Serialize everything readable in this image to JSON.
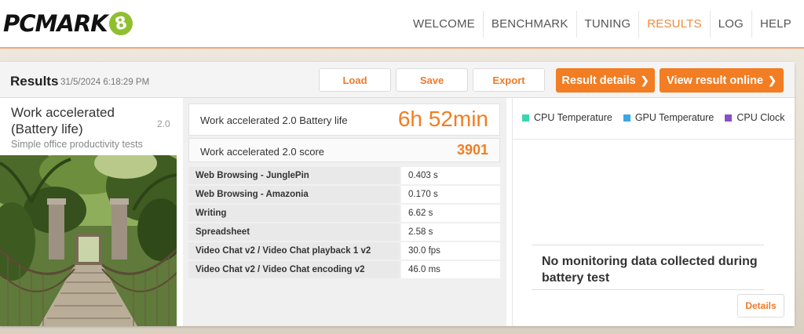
{
  "header": {
    "logo_text": "PCMARK",
    "logo_badge": "8",
    "nav": [
      "WELCOME",
      "BENCHMARK",
      "TUNING",
      "RESULTS",
      "LOG",
      "HELP"
    ],
    "active_nav": "RESULTS"
  },
  "results": {
    "title": "Results",
    "date": "31/5/2024 6:18:29 PM",
    "buttons": {
      "load": "Load",
      "save": "Save",
      "export": "Export",
      "result_details": "Result details",
      "view_online": "View result online"
    }
  },
  "test": {
    "name": "Work accelerated (Battery life)",
    "version": "2.0",
    "description": "Simple office productivity tests"
  },
  "scores": {
    "battery_label": "Work accelerated 2.0 Battery life",
    "battery_value": "6h 52min",
    "score_label": "Work accelerated 2.0 score",
    "score_value": "3901"
  },
  "subtests": [
    {
      "name": "Web Browsing - JunglePin",
      "value": "0.403 s"
    },
    {
      "name": "Web Browsing - Amazonia",
      "value": "0.170 s"
    },
    {
      "name": "Writing",
      "value": "6.62 s"
    },
    {
      "name": "Spreadsheet",
      "value": "2.58 s"
    },
    {
      "name": "Video Chat v2 / Video Chat playback 1 v2",
      "value": "30.0 fps"
    },
    {
      "name": "Video Chat v2 / Video Chat encoding v2",
      "value": "46.0 ms"
    }
  ],
  "monitoring": {
    "legend": [
      {
        "label": "CPU Temperature",
        "color": "#3ad6b0"
      },
      {
        "label": "GPU Temperature",
        "color": "#3aa8e8"
      },
      {
        "label": "CPU Clock",
        "color": "#8a4fc8"
      }
    ],
    "no_data_message": "No monitoring data collected during battery test",
    "details_button": "Details"
  },
  "colors": {
    "accent": "#f27d22",
    "accent_text": "#f07a2a"
  }
}
